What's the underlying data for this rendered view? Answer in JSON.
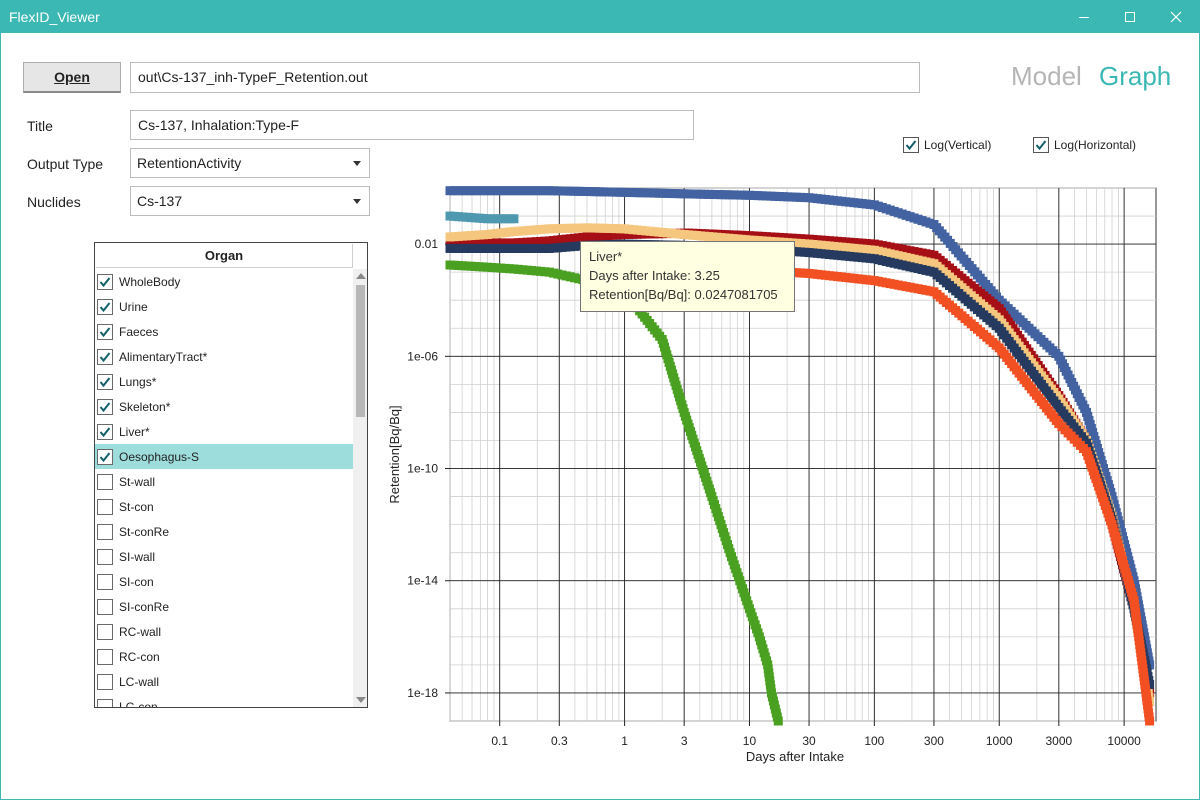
{
  "window": {
    "title": "FlexID_Viewer"
  },
  "toolbar": {
    "open_label": "Open",
    "file_path": "out\\Cs-137_inh-TypeF_Retention.out"
  },
  "nav": {
    "model_label": "Model",
    "graph_label": "Graph",
    "active": "Graph"
  },
  "form": {
    "title_label": "Title",
    "title_value": "Cs-137, Inhalation:Type-F",
    "output_type_label": "Output Type",
    "output_type_value": "RetentionActivity",
    "nuclides_label": "Nuclides",
    "nuclides_value": "Cs-137"
  },
  "log_options": {
    "vertical_label": "Log(Vertical)",
    "vertical_checked": true,
    "horizontal_label": "Log(Horizontal)",
    "horizontal_checked": true
  },
  "organ_panel": {
    "header": "Organ",
    "items": [
      {
        "label": "WholeBody",
        "checked": true
      },
      {
        "label": "Urine",
        "checked": true
      },
      {
        "label": "Faeces",
        "checked": true
      },
      {
        "label": "AlimentaryTract*",
        "checked": true
      },
      {
        "label": "Lungs*",
        "checked": true
      },
      {
        "label": "Skeleton*",
        "checked": true
      },
      {
        "label": "Liver*",
        "checked": true
      },
      {
        "label": "Oesophagus-S",
        "checked": true,
        "selected": true
      },
      {
        "label": "St-wall",
        "checked": false
      },
      {
        "label": "St-con",
        "checked": false
      },
      {
        "label": "St-conRe",
        "checked": false
      },
      {
        "label": "SI-wall",
        "checked": false
      },
      {
        "label": "SI-con",
        "checked": false
      },
      {
        "label": "SI-conRe",
        "checked": false
      },
      {
        "label": "RC-wall",
        "checked": false
      },
      {
        "label": "RC-con",
        "checked": false
      },
      {
        "label": "LC-wall",
        "checked": false
      },
      {
        "label": "LC-con",
        "checked": false
      }
    ]
  },
  "tooltip": {
    "series": "Liver*",
    "line1": "Days after Intake: 3.25",
    "line2": "Retention[Bq/Bq]: 0.0247081705"
  },
  "chart_data": {
    "type": "scatter",
    "xlabel": "Days after Intake",
    "ylabel": "Retention[Bq/Bq]",
    "x_scale": "log",
    "y_scale": "log",
    "xlim": [
      0.04,
      18000
    ],
    "ylim": [
      1e-19,
      1
    ],
    "x_ticks": [
      0.1,
      0.3,
      1,
      3,
      10,
      30,
      100,
      300,
      1000,
      3000,
      10000
    ],
    "x_tick_labels": [
      "0.1",
      "0.3",
      "1",
      "3",
      "10",
      "30",
      "100",
      "300",
      "1000",
      "3000",
      "10000"
    ],
    "y_ticks": [
      0.01,
      1e-06,
      1e-10,
      1e-14,
      1e-18
    ],
    "y_tick_labels": [
      "0.01",
      "1e-06",
      "1e-10",
      "1e-14",
      "1e-18"
    ],
    "grid": true,
    "series": [
      {
        "color": "#4262a1",
        "x": [
          0.04,
          0.08,
          0.13,
          0.25,
          0.5,
          1,
          3,
          10,
          30,
          100,
          300,
          1000,
          3000,
          5000,
          8000,
          12000,
          16000
        ],
        "y": [
          0.8,
          0.8,
          0.8,
          0.8,
          0.75,
          0.7,
          0.62,
          0.55,
          0.45,
          0.25,
          0.05,
          0.0001,
          1e-06,
          1e-08,
          1e-11,
          1e-14,
          1e-17
        ]
      },
      {
        "color": "#a50f15",
        "x": [
          0.04,
          0.08,
          0.13,
          0.25,
          0.5,
          1,
          3.25,
          10,
          30,
          100,
          300,
          1000,
          3000,
          5000,
          8000,
          12000,
          16000
        ],
        "y": [
          0.011,
          0.011,
          0.011,
          0.013,
          0.018,
          0.022,
          0.0247,
          0.02,
          0.015,
          0.01,
          0.004,
          5e-05,
          4e-08,
          1e-09,
          1e-12,
          1e-15,
          1e-18
        ]
      },
      {
        "color": "#f5c77e",
        "x": [
          0.04,
          0.08,
          0.13,
          0.25,
          0.5,
          1,
          3,
          10,
          30,
          100,
          300,
          1000,
          3000,
          5000,
          8000,
          12000,
          16000
        ],
        "y": [
          0.018,
          0.022,
          0.028,
          0.035,
          0.038,
          0.035,
          0.022,
          0.014,
          0.01,
          0.006,
          0.002,
          2e-05,
          3e-08,
          1e-09,
          2e-12,
          1e-15,
          5e-19
        ]
      },
      {
        "color": "#253a5e",
        "x": [
          0.04,
          0.08,
          0.13,
          0.25,
          0.5,
          1,
          3,
          10,
          30,
          100,
          300,
          1000,
          3000,
          5000,
          8000,
          12000,
          16000
        ],
        "y": [
          0.007,
          0.007,
          0.007,
          0.007,
          0.009,
          0.01,
          0.009,
          0.007,
          0.005,
          0.003,
          0.001,
          1e-05,
          1.5e-08,
          8e-10,
          1.5e-12,
          1e-15,
          2e-18
        ]
      },
      {
        "color": "#4f99b0",
        "x": [
          0.04,
          0.08,
          0.13
        ],
        "y": [
          0.1,
          0.08,
          0.08
        ]
      },
      {
        "color": "#f25022",
        "x": [
          0.5,
          1,
          3,
          10,
          30,
          100,
          300,
          1000,
          3000,
          5000,
          8000,
          12000,
          16000
        ],
        "y": [
          0.0008,
          0.0012,
          0.0015,
          0.0012,
          0.0009,
          0.0005,
          0.0002,
          2e-06,
          4e-09,
          4e-10,
          1e-12,
          2e-15,
          1e-19
        ]
      },
      {
        "color": "#4aa020",
        "x": [
          0.04,
          0.08,
          0.13,
          0.25,
          0.5,
          1,
          2,
          3,
          5,
          7,
          10,
          12,
          14,
          15,
          17
        ],
        "y": [
          0.0018,
          0.0015,
          0.0013,
          0.001,
          0.0005,
          0.0002,
          4e-06,
          1e-08,
          1e-11,
          1e-13,
          1e-15,
          1e-16,
          1e-17,
          1e-18,
          1e-19
        ]
      }
    ]
  }
}
